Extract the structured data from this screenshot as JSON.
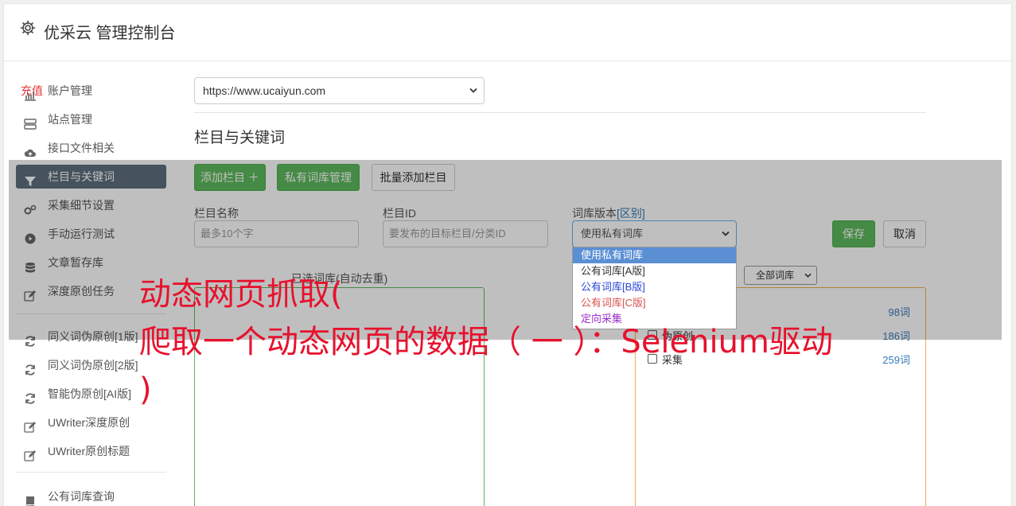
{
  "header": {
    "title": "优采云 管理控制台"
  },
  "sidebar": {
    "items": [
      {
        "label": "账户管理",
        "extra": "充值",
        "icon": "bar-chart-icon"
      },
      {
        "label": "站点管理",
        "icon": "server-icon"
      },
      {
        "label": "接口文件相关",
        "icon": "cloud-upload-icon"
      },
      {
        "label": "栏目与关键词",
        "icon": "filter-icon",
        "active": true
      },
      {
        "label": "采集细节设置",
        "icon": "cogs-icon"
      },
      {
        "label": "手动运行测试",
        "icon": "play-circle-icon"
      },
      {
        "label": "文章暂存库",
        "icon": "database-icon"
      },
      {
        "label": "深度原创任务",
        "icon": "edit-icon"
      },
      {
        "label": "同义词伪原创[1版]",
        "icon": "refresh-icon"
      },
      {
        "label": "同义词伪原创[2版]",
        "icon": "refresh-icon"
      },
      {
        "label": "智能伪原创[AI版]",
        "icon": "refresh-icon"
      },
      {
        "label": "UWriter深度原创",
        "icon": "edit-icon"
      },
      {
        "label": "UWriter原创标题",
        "icon": "edit-icon"
      },
      {
        "label": "公有词库查询",
        "icon": "book-icon"
      }
    ]
  },
  "main": {
    "site_select_value": "https://www.ucaiyun.com",
    "section_title": "栏目与关键词",
    "buttons": {
      "add_column": "添加栏目 ＋",
      "private_lib": "私有词库管理",
      "batch_add": "批量添加栏目",
      "save": "保存",
      "cancel": "取消"
    },
    "form": {
      "name_label": "栏目名称",
      "name_placeholder": "最多10个字",
      "id_label": "栏目ID",
      "id_placeholder": "要发布的目标栏目/分类ID",
      "version_label": "词库版本",
      "version_link": "[区别]",
      "version_value": "使用私有词库"
    },
    "dropdown_options": [
      {
        "label": "使用私有词库",
        "color": "#ffffff",
        "selected": true
      },
      {
        "label": "公有词库[A版]",
        "color": "#333333"
      },
      {
        "label": "公有词库[B版]",
        "color": "#2b46d8"
      },
      {
        "label": "公有词库[C版]",
        "color": "#d9534f"
      },
      {
        "label": "定向采集",
        "color": "#9b2fc9"
      }
    ],
    "selected_caption": "已选词库(自动去重)",
    "filter_select": "全部词库",
    "libraries": [
      {
        "name": "",
        "count": "98词"
      },
      {
        "name": "伪原创",
        "count": "186词"
      },
      {
        "name": "采集",
        "count": "259词"
      }
    ]
  },
  "overlay_text": {
    "line1": "动态网页抓取(",
    "line2": "爬取一个动态网页的数据（ 一 ）：Selenium驱动",
    "line3": ")"
  },
  "colors": {
    "overlay_text": "#e8112d",
    "green": "#5cb85c",
    "orange": "#f0ad4e"
  }
}
